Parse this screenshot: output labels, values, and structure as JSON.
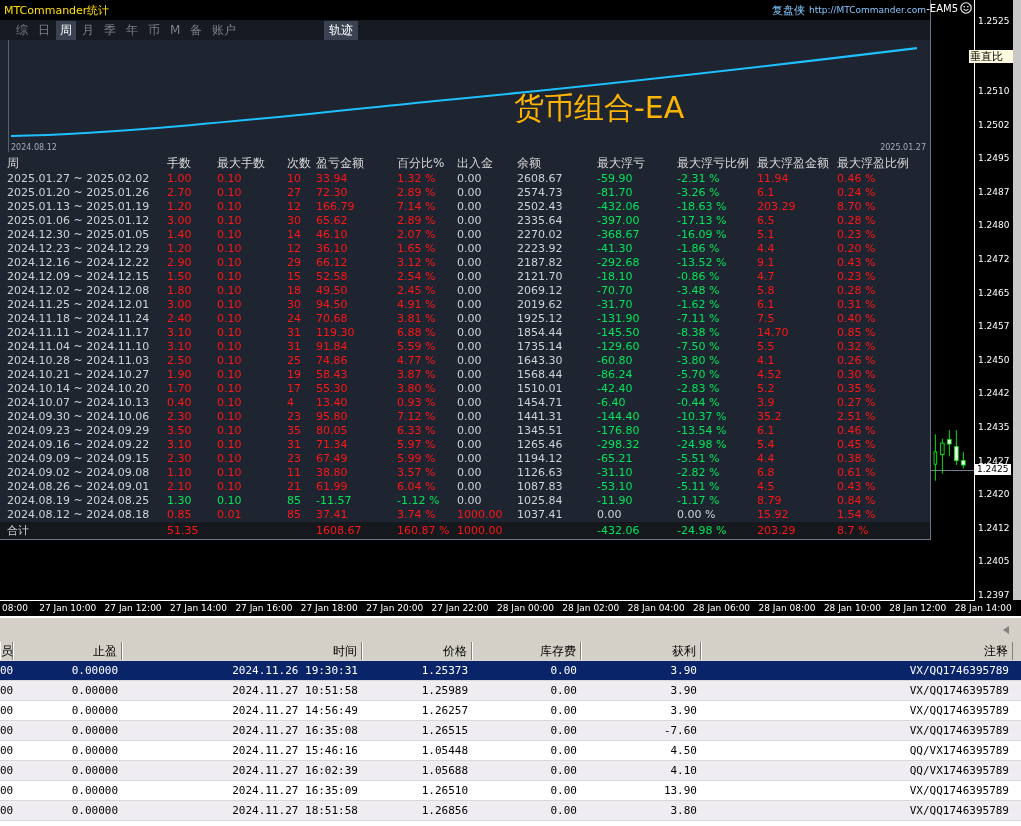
{
  "stats_window": {
    "title": "MTCommander统计",
    "brand": "复盘侠",
    "link": "http://MTCommander.com",
    "tabs": [
      {
        "label": "综",
        "selected": false
      },
      {
        "label": "日",
        "selected": false
      },
      {
        "label": "周",
        "selected": true
      },
      {
        "label": "月",
        "selected": false
      },
      {
        "label": "季",
        "selected": false
      },
      {
        "label": "年",
        "selected": false
      },
      {
        "label": "币",
        "selected": false
      },
      {
        "label": "M",
        "selected": false
      },
      {
        "label": "备",
        "selected": false
      },
      {
        "label": "账户",
        "selected": false
      }
    ],
    "view_toggle": {
      "label": "轨迹",
      "selected": true
    },
    "equity_chart": {
      "start_label": "2024.08.12",
      "end_label": "2025.01.27",
      "caption": "货币组合-EA"
    },
    "table": {
      "columns": [
        "周",
        "手数",
        "最大手数",
        "次数",
        "盈亏金额",
        "百分比%",
        "出入金",
        "余额",
        "最大浮亏",
        "最大浮亏比例",
        "最大浮盈金额",
        "最大浮盈比例"
      ],
      "rows": [
        {
          "cells": [
            "2025.01.27 ~ 2025.02.02",
            "1.00",
            "0.10",
            "10",
            "33.94",
            "1.32 %",
            "0.00",
            "2608.67",
            "-59.90",
            "-2.31 %",
            "11.94",
            "0.46 %"
          ],
          "loss": false,
          "deposit": false,
          "drawdown": true
        },
        {
          "cells": [
            "2025.01.20 ~ 2025.01.26",
            "2.70",
            "0.10",
            "27",
            "72.30",
            "2.89 %",
            "0.00",
            "2574.73",
            "-81.70",
            "-3.26 %",
            "6.1",
            "0.24 %"
          ],
          "loss": false,
          "deposit": false,
          "drawdown": true
        },
        {
          "cells": [
            "2025.01.13 ~ 2025.01.19",
            "1.20",
            "0.10",
            "12",
            "166.79",
            "7.14 %",
            "0.00",
            "2502.43",
            "-432.06",
            "-18.63 %",
            "203.29",
            "8.70 %"
          ],
          "loss": false,
          "deposit": false,
          "drawdown": true
        },
        {
          "cells": [
            "2025.01.06 ~ 2025.01.12",
            "3.00",
            "0.10",
            "30",
            "65.62",
            "2.89 %",
            "0.00",
            "2335.64",
            "-397.00",
            "-17.13 %",
            "6.5",
            "0.28 %"
          ],
          "loss": false,
          "deposit": false,
          "drawdown": true
        },
        {
          "cells": [
            "2024.12.30 ~ 2025.01.05",
            "1.40",
            "0.10",
            "14",
            "46.10",
            "2.07 %",
            "0.00",
            "2270.02",
            "-368.67",
            "-16.09 %",
            "5.1",
            "0.23 %"
          ],
          "loss": false,
          "deposit": false,
          "drawdown": true
        },
        {
          "cells": [
            "2024.12.23 ~ 2024.12.29",
            "1.20",
            "0.10",
            "12",
            "36.10",
            "1.65 %",
            "0.00",
            "2223.92",
            "-41.30",
            "-1.86 %",
            "4.4",
            "0.20 %"
          ],
          "loss": false,
          "deposit": false,
          "drawdown": true
        },
        {
          "cells": [
            "2024.12.16 ~ 2024.12.22",
            "2.90",
            "0.10",
            "29",
            "66.12",
            "3.12 %",
            "0.00",
            "2187.82",
            "-292.68",
            "-13.52 %",
            "9.1",
            "0.43 %"
          ],
          "loss": false,
          "deposit": false,
          "drawdown": true
        },
        {
          "cells": [
            "2024.12.09 ~ 2024.12.15",
            "1.50",
            "0.10",
            "15",
            "52.58",
            "2.54 %",
            "0.00",
            "2121.70",
            "-18.10",
            "-0.86 %",
            "4.7",
            "0.23 %"
          ],
          "loss": false,
          "deposit": false,
          "drawdown": true
        },
        {
          "cells": [
            "2024.12.02 ~ 2024.12.08",
            "1.80",
            "0.10",
            "18",
            "49.50",
            "2.45 %",
            "0.00",
            "2069.12",
            "-70.70",
            "-3.48 %",
            "5.8",
            "0.28 %"
          ],
          "loss": false,
          "deposit": false,
          "drawdown": true
        },
        {
          "cells": [
            "2024.11.25 ~ 2024.12.01",
            "3.00",
            "0.10",
            "30",
            "94.50",
            "4.91 %",
            "0.00",
            "2019.62",
            "-31.70",
            "-1.62 %",
            "6.1",
            "0.31 %"
          ],
          "loss": false,
          "deposit": false,
          "drawdown": true
        },
        {
          "cells": [
            "2024.11.18 ~ 2024.11.24",
            "2.40",
            "0.10",
            "24",
            "70.68",
            "3.81 %",
            "0.00",
            "1925.12",
            "-131.90",
            "-7.11 %",
            "7.5",
            "0.40 %"
          ],
          "loss": false,
          "deposit": false,
          "drawdown": true
        },
        {
          "cells": [
            "2024.11.11 ~ 2024.11.17",
            "3.10",
            "0.10",
            "31",
            "119.30",
            "6.88 %",
            "0.00",
            "1854.44",
            "-145.50",
            "-8.38 %",
            "14.70",
            "0.85 %"
          ],
          "loss": false,
          "deposit": false,
          "drawdown": true
        },
        {
          "cells": [
            "2024.11.04 ~ 2024.11.10",
            "3.10",
            "0.10",
            "31",
            "91.84",
            "5.59 %",
            "0.00",
            "1735.14",
            "-129.60",
            "-7.50 %",
            "5.5",
            "0.32 %"
          ],
          "loss": false,
          "deposit": false,
          "drawdown": true
        },
        {
          "cells": [
            "2024.10.28 ~ 2024.11.03",
            "2.50",
            "0.10",
            "25",
            "74.86",
            "4.77 %",
            "0.00",
            "1643.30",
            "-60.80",
            "-3.80 %",
            "4.1",
            "0.26 %"
          ],
          "loss": false,
          "deposit": false,
          "drawdown": true
        },
        {
          "cells": [
            "2024.10.21 ~ 2024.10.27",
            "1.90",
            "0.10",
            "19",
            "58.43",
            "3.87 %",
            "0.00",
            "1568.44",
            "-86.24",
            "-5.70 %",
            "4.52",
            "0.30 %"
          ],
          "loss": false,
          "deposit": false,
          "drawdown": true
        },
        {
          "cells": [
            "2024.10.14 ~ 2024.10.20",
            "1.70",
            "0.10",
            "17",
            "55.30",
            "3.80 %",
            "0.00",
            "1510.01",
            "-42.40",
            "-2.83 %",
            "5.2",
            "0.35 %"
          ],
          "loss": false,
          "deposit": false,
          "drawdown": true
        },
        {
          "cells": [
            "2024.10.07 ~ 2024.10.13",
            "0.40",
            "0.10",
            "4",
            "13.40",
            "0.93 %",
            "0.00",
            "1454.71",
            "-6.40",
            "-0.44 %",
            "3.9",
            "0.27 %"
          ],
          "loss": false,
          "deposit": false,
          "drawdown": true
        },
        {
          "cells": [
            "2024.09.30 ~ 2024.10.06",
            "2.30",
            "0.10",
            "23",
            "95.80",
            "7.12 %",
            "0.00",
            "1441.31",
            "-144.40",
            "-10.37 %",
            "35.2",
            "2.51 %"
          ],
          "loss": false,
          "deposit": false,
          "drawdown": true
        },
        {
          "cells": [
            "2024.09.23 ~ 2024.09.29",
            "3.50",
            "0.10",
            "35",
            "80.05",
            "6.33 %",
            "0.00",
            "1345.51",
            "-176.80",
            "-13.54 %",
            "6.1",
            "0.46 %"
          ],
          "loss": false,
          "deposit": false,
          "drawdown": true
        },
        {
          "cells": [
            "2024.09.16 ~ 2024.09.22",
            "3.10",
            "0.10",
            "31",
            "71.34",
            "5.97 %",
            "0.00",
            "1265.46",
            "-298.32",
            "-24.98 %",
            "5.4",
            "0.45 %"
          ],
          "loss": false,
          "deposit": false,
          "drawdown": true
        },
        {
          "cells": [
            "2024.09.09 ~ 2024.09.15",
            "2.30",
            "0.10",
            "23",
            "67.49",
            "5.99 %",
            "0.00",
            "1194.12",
            "-65.21",
            "-5.51 %",
            "4.4",
            "0.38 %"
          ],
          "loss": false,
          "deposit": false,
          "drawdown": true
        },
        {
          "cells": [
            "2024.09.02 ~ 2024.09.08",
            "1.10",
            "0.10",
            "11",
            "38.80",
            "3.57 %",
            "0.00",
            "1126.63",
            "-31.10",
            "-2.82 %",
            "6.8",
            "0.61 %"
          ],
          "loss": false,
          "deposit": false,
          "drawdown": true
        },
        {
          "cells": [
            "2024.08.26 ~ 2024.09.01",
            "2.10",
            "0.10",
            "21",
            "61.99",
            "6.04 %",
            "0.00",
            "1087.83",
            "-53.10",
            "-5.11 %",
            "4.5",
            "0.43 %"
          ],
          "loss": false,
          "deposit": false,
          "drawdown": true
        },
        {
          "cells": [
            "2024.08.19 ~ 2024.08.25",
            "1.30",
            "0.10",
            "85",
            "-11.57",
            "-1.12 %",
            "0.00",
            "1025.84",
            "-11.90",
            "-1.17 %",
            "8.79",
            "0.84 %"
          ],
          "loss": true,
          "deposit": false,
          "drawdown": true
        },
        {
          "cells": [
            "2024.08.12 ~ 2024.08.18",
            "0.85",
            "0.01",
            "85",
            "37.41",
            "3.74 %",
            "1000.00",
            "1037.41",
            "0.00",
            "0.00 %",
            "15.92",
            "1.54 %"
          ],
          "loss": false,
          "deposit": true,
          "drawdown": false
        }
      ],
      "total": {
        "cells": [
          "合计",
          "51.35",
          null,
          null,
          "1608.67",
          "160.87 %",
          "1000.00",
          null,
          "-432.06",
          "-24.98 %",
          "203.29",
          "8.7 %"
        ],
        "loss": false,
        "deposit": true,
        "drawdown": true
      }
    }
  },
  "price_chart": {
    "symbol": "-EAM5",
    "tool_label": "垂直比",
    "current_price": "1.2425",
    "price_labels": [
      "1.2525",
      "1.2510",
      "1.2502",
      "1.2495",
      "1.2487",
      "1.2480",
      "1.2472",
      "1.2465",
      "1.2457",
      "1.2450",
      "1.2442",
      "1.2435",
      "1.2427",
      "1.2420",
      "1.2412",
      "1.2405",
      "1.2397"
    ],
    "time_labels": [
      "08:00",
      "27 Jan 10:00",
      "27 Jan 12:00",
      "27 Jan 14:00",
      "27 Jan 16:00",
      "27 Jan 18:00",
      "27 Jan 20:00",
      "27 Jan 22:00",
      "28 Jan 00:00",
      "28 Jan 02:00",
      "28 Jan 04:00",
      "28 Jan 06:00",
      "28 Jan 08:00",
      "28 Jan 10:00",
      "28 Jan 12:00",
      "28 Jan 14:00"
    ]
  },
  "terminal": {
    "columns": [
      "员",
      "止盈",
      "时间",
      "价格",
      "库存费",
      "获利",
      "注释"
    ],
    "rows": [
      {
        "cells": [
          "00",
          "0.00000",
          "2024.11.26 19:30:31",
          "1.25373",
          "0.00",
          "3.90",
          "VX/QQ1746395789"
        ],
        "selected": true
      },
      {
        "cells": [
          "00",
          "0.00000",
          "2024.11.27 10:51:58",
          "1.25989",
          "0.00",
          "3.90",
          "VX/QQ1746395789"
        ],
        "selected": false
      },
      {
        "cells": [
          "00",
          "0.00000",
          "2024.11.27 14:56:49",
          "1.26257",
          "0.00",
          "3.90",
          "VX/QQ1746395789"
        ],
        "selected": false
      },
      {
        "cells": [
          "00",
          "0.00000",
          "2024.11.27 16:35:08",
          "1.26515",
          "0.00",
          "-7.60",
          "VX/QQ1746395789"
        ],
        "selected": false
      },
      {
        "cells": [
          "00",
          "0.00000",
          "2024.11.27 15:46:16",
          "1.05448",
          "0.00",
          "4.50",
          "QQ/VX1746395789"
        ],
        "selected": false
      },
      {
        "cells": [
          "00",
          "0.00000",
          "2024.11.27 16:02:39",
          "1.05688",
          "0.00",
          "4.10",
          "QQ/VX1746395789"
        ],
        "selected": false
      },
      {
        "cells": [
          "00",
          "0.00000",
          "2024.11.27 16:35:09",
          "1.26510",
          "0.00",
          "13.90",
          "VX/QQ1746395789"
        ],
        "selected": false
      },
      {
        "cells": [
          "00",
          "0.00000",
          "2024.11.27 18:51:58",
          "1.26856",
          "0.00",
          "3.80",
          "VX/QQ1746395789"
        ],
        "selected": false
      }
    ]
  }
}
